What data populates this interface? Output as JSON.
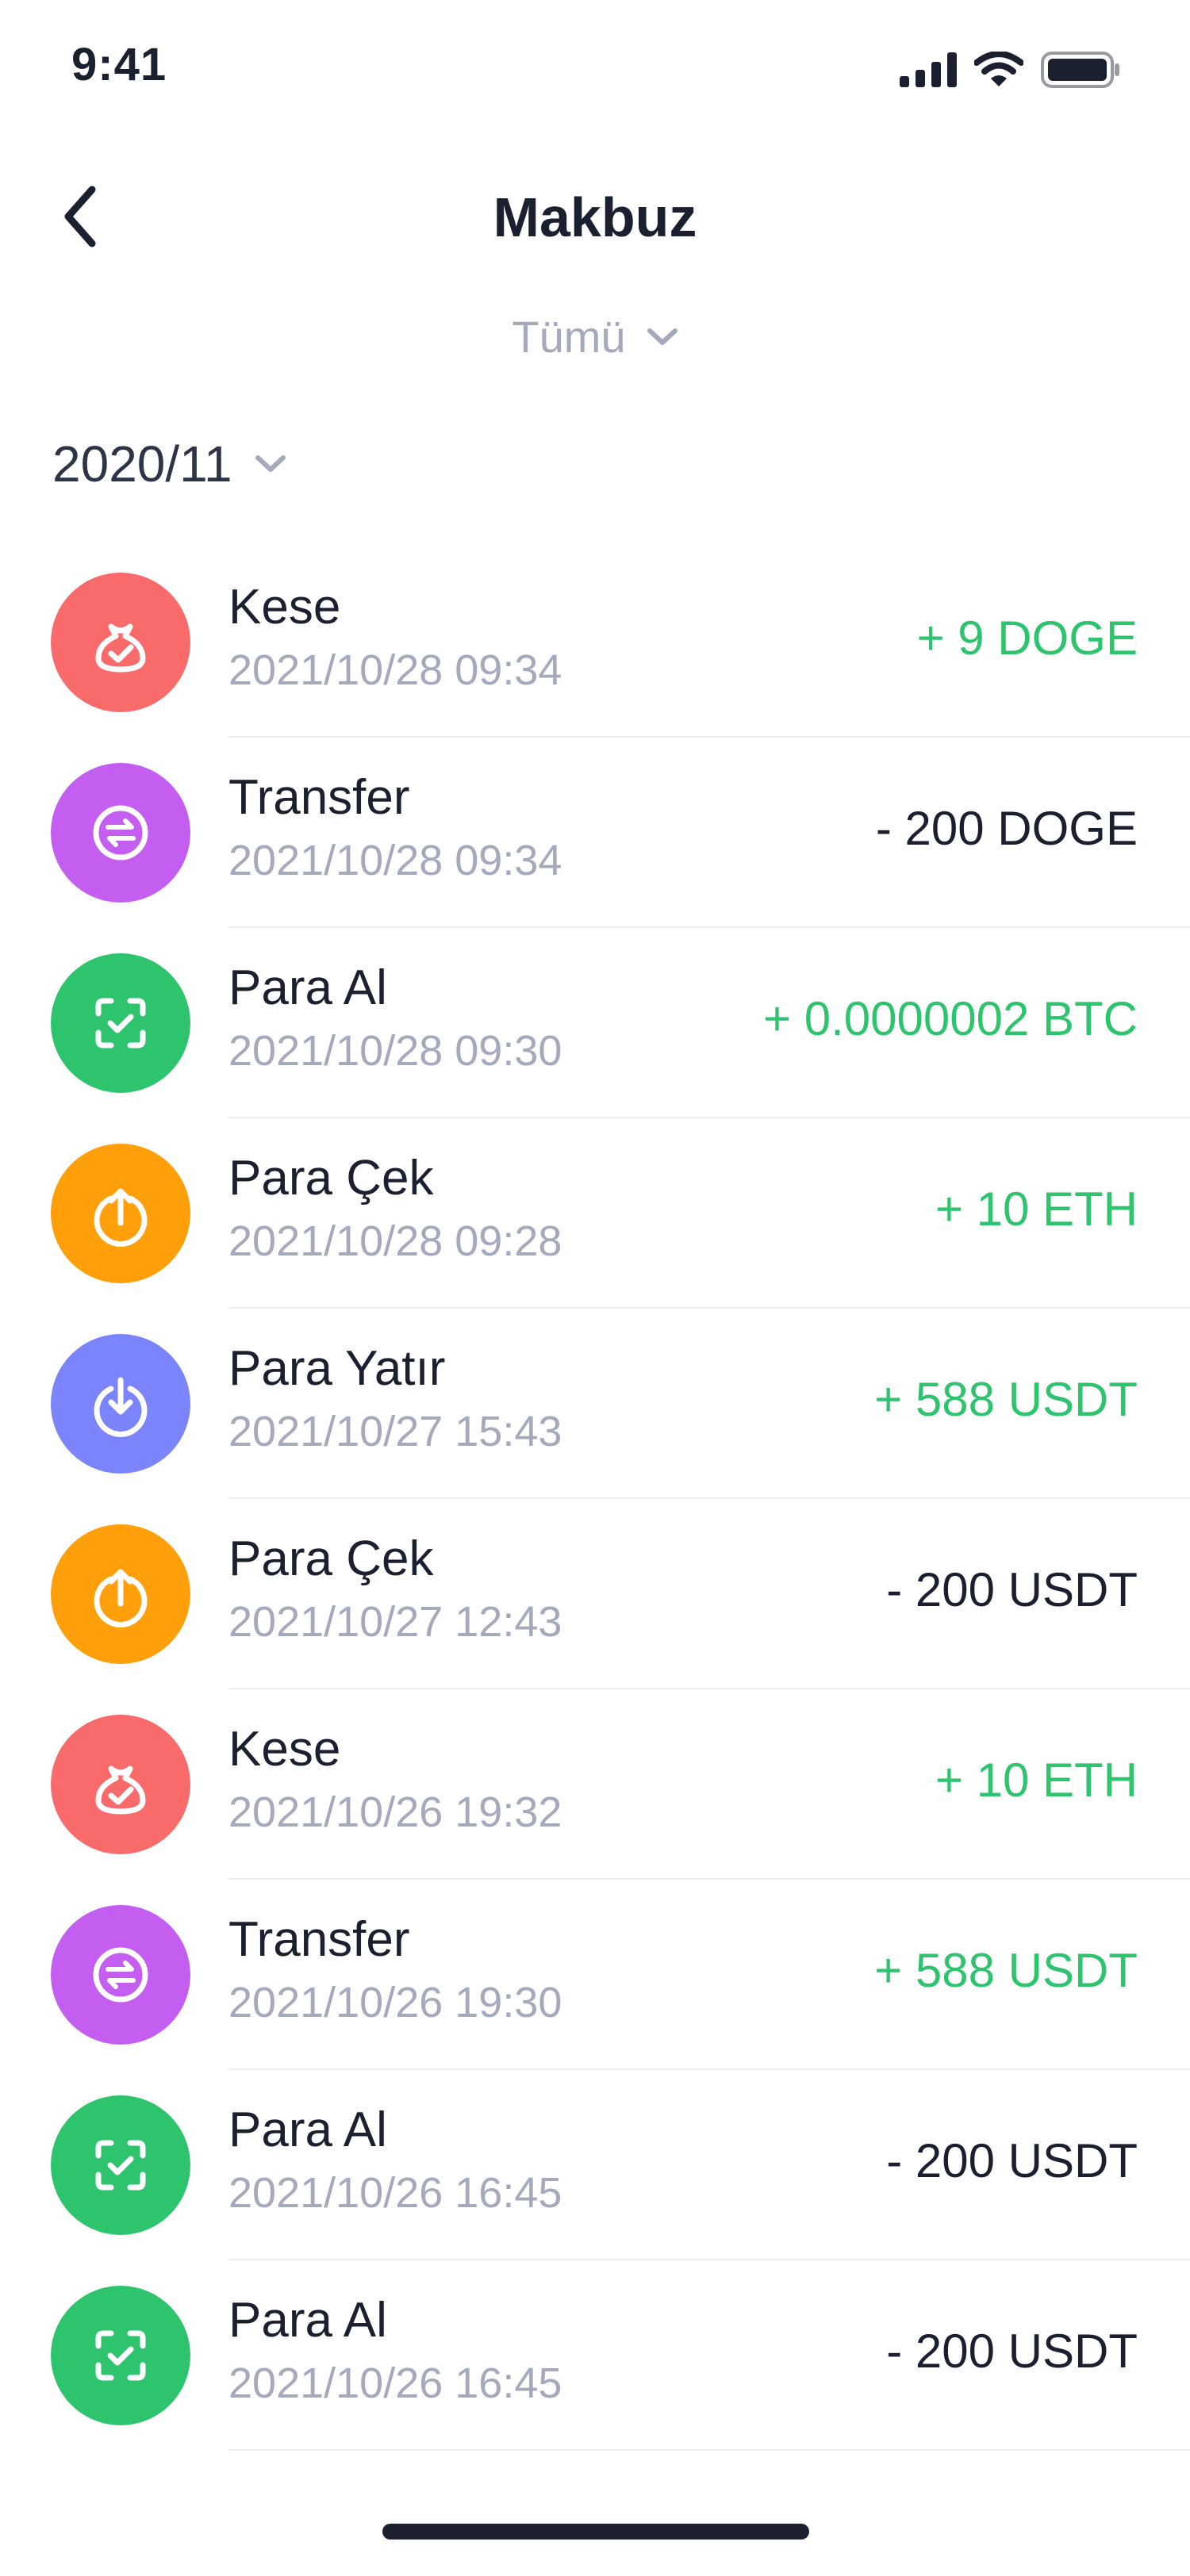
{
  "status_bar": {
    "time": "9:41"
  },
  "header": {
    "title": "Makbuz"
  },
  "filter": {
    "label": "Tümü"
  },
  "month": {
    "label": "2020/11"
  },
  "colors": {
    "positive": "#2ec46e",
    "negative": "#1b2030",
    "kese": "#f96b6b",
    "transfer": "#c45ef0",
    "para_al": "#2ec46e",
    "para_cek": "#ff9f0a",
    "para_yatir": "#7b84fb"
  },
  "transactions": [
    {
      "type": "kese",
      "icon": "pouch-check-icon",
      "title": "Kese",
      "date": "2021/10/28 09:34",
      "amount": "+ 9 DOGE",
      "positive": true
    },
    {
      "type": "transfer",
      "icon": "swap-arrows-icon",
      "title": "Transfer",
      "date": "2021/10/28 09:34",
      "amount": "- 200 DOGE",
      "positive": false
    },
    {
      "type": "para_al",
      "icon": "scan-check-icon",
      "title": "Para Al",
      "date": "2021/10/28 09:30",
      "amount": "+ 0.0000002 BTC",
      "positive": true
    },
    {
      "type": "para_cek",
      "icon": "arrow-up-circle-icon",
      "title": "Para Çek",
      "date": "2021/10/28 09:28",
      "amount": "+ 10 ETH",
      "positive": true
    },
    {
      "type": "para_yatir",
      "icon": "arrow-down-circle-icon",
      "title": "Para Yatır",
      "date": "2021/10/27 15:43",
      "amount": "+ 588 USDT",
      "positive": true
    },
    {
      "type": "para_cek",
      "icon": "arrow-up-circle-icon",
      "title": "Para Çek",
      "date": "2021/10/27 12:43",
      "amount": "- 200 USDT",
      "positive": false
    },
    {
      "type": "kese",
      "icon": "pouch-check-icon",
      "title": "Kese",
      "date": "2021/10/26 19:32",
      "amount": "+ 10 ETH",
      "positive": true
    },
    {
      "type": "transfer",
      "icon": "swap-arrows-icon",
      "title": "Transfer",
      "date": "2021/10/26 19:30",
      "amount": "+ 588 USDT",
      "positive": true
    },
    {
      "type": "para_al",
      "icon": "scan-check-icon",
      "title": "Para Al",
      "date": "2021/10/26 16:45",
      "amount": "- 200 USDT",
      "positive": false
    },
    {
      "type": "para_al",
      "icon": "scan-check-icon",
      "title": "Para Al",
      "date": "2021/10/26 16:45",
      "amount": "- 200 USDT",
      "positive": false
    }
  ]
}
